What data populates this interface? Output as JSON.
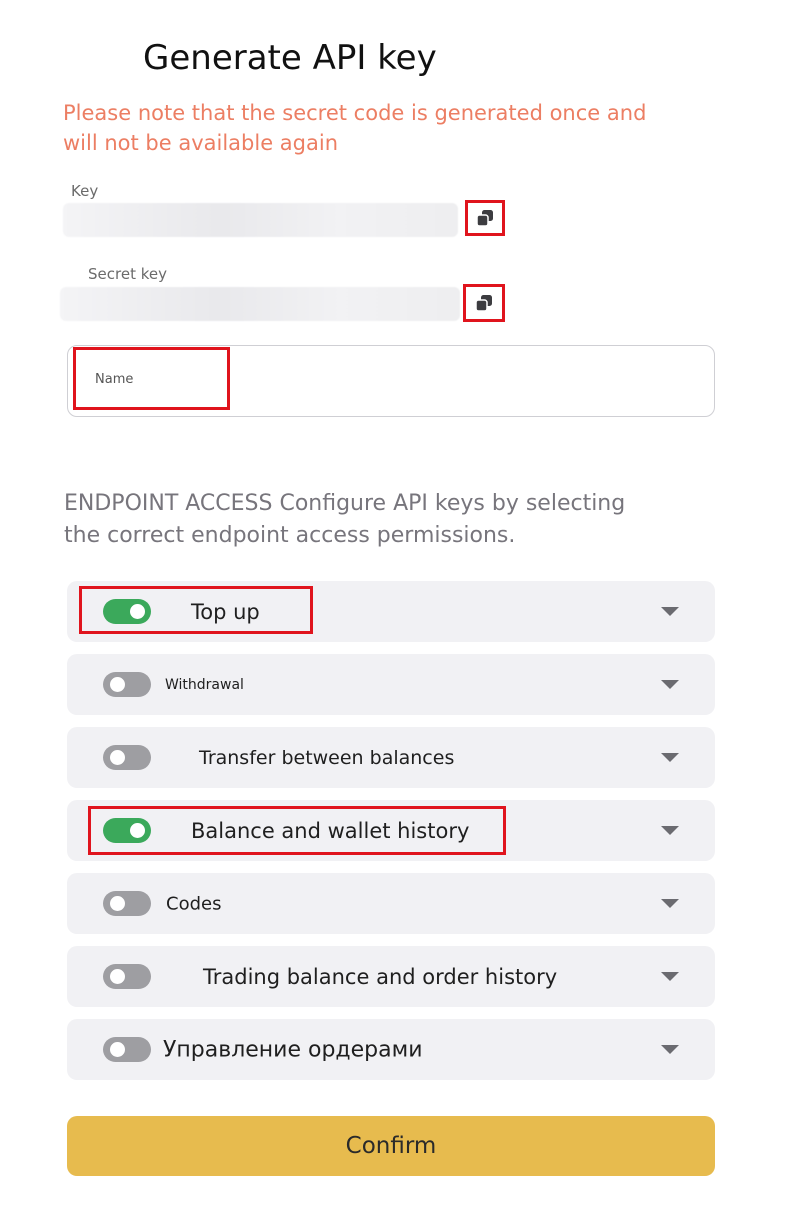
{
  "header": {
    "title": "Generate API key"
  },
  "warning": "Please note that the secret code is generated once and will not be available again",
  "key_field": {
    "label": "Key",
    "copy_icon": "copy-icon"
  },
  "secret_field": {
    "label": "Secret key",
    "copy_icon": "copy-icon"
  },
  "name_input": {
    "placeholder": "Name",
    "value": ""
  },
  "endpoint_section": {
    "text": "ENDPOINT ACCESS Configure API keys by selecting the correct endpoint access permissions."
  },
  "permissions": [
    {
      "label": "Top up",
      "enabled": true
    },
    {
      "label": "Withdrawal",
      "enabled": false
    },
    {
      "label": "Transfer between balances",
      "enabled": false
    },
    {
      "label": "Balance and wallet history",
      "enabled": true
    },
    {
      "label": "Codes",
      "enabled": false
    },
    {
      "label": "Trading balance and order history",
      "enabled": false
    },
    {
      "label": "Управление ордерами",
      "enabled": false
    }
  ],
  "confirm_label": "Confirm",
  "colors": {
    "warning": "#ec7e63",
    "toggle_on": "#3ba95b",
    "toggle_off": "#9e9ea2",
    "confirm_bg": "#e7bb4e",
    "highlight": "#e0141d"
  }
}
